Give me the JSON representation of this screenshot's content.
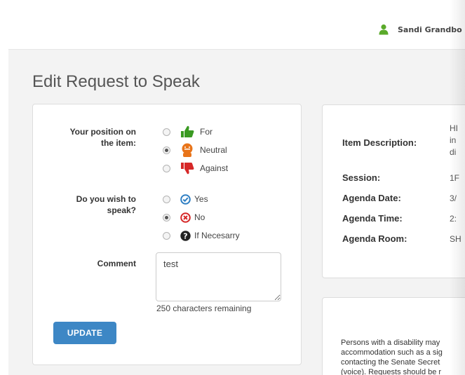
{
  "header": {
    "user_name": "Sandi Grandbo"
  },
  "page": {
    "title": "Edit Request to Speak"
  },
  "form": {
    "position": {
      "label_line1": "Your position on",
      "label_line2": "the item:",
      "options": [
        {
          "label": "For",
          "icon": "thumbs-up-icon",
          "color": "#3a9a22",
          "checked": false
        },
        {
          "label": "Neutral",
          "icon": "neutral-face-icon",
          "color": "#e8741a",
          "checked": true
        },
        {
          "label": "Against",
          "icon": "thumbs-down-icon",
          "color": "#d62828",
          "checked": false
        }
      ]
    },
    "speak": {
      "label_line1": "Do you wish to",
      "label_line2": "speak?",
      "options": [
        {
          "label": "Yes",
          "icon": "check-circle-icon",
          "color": "#2f7fc3",
          "checked": false
        },
        {
          "label": "No",
          "icon": "x-circle-icon",
          "color": "#d62828",
          "checked": true
        },
        {
          "label": "If Necesarry",
          "icon": "question-circle-icon",
          "color": "#222222",
          "checked": false
        }
      ]
    },
    "comment": {
      "label": "Comment",
      "value": "test",
      "chars_remaining": "250 characters remaining"
    },
    "update_button": "UPDATE"
  },
  "info": {
    "item_description_label": "Item Description:",
    "item_description_value": [
      "HI",
      "in",
      "di"
    ],
    "session_label": "Session:",
    "session_value": "1F",
    "agenda_date_label": "Agenda Date:",
    "agenda_date_value": "3/",
    "agenda_time_label": "Agenda Time:",
    "agenda_time_value": "2:",
    "agenda_room_label": "Agenda Room:",
    "agenda_room_value": "SH"
  },
  "note": {
    "lines": [
      "Persons with a disability may",
      "accommodation such as a sig",
      "contacting the Senate Secret",
      "(voice). Requests should be r"
    ]
  },
  "colors": {
    "accent": "#3d87c5",
    "user_icon": "#5aaa2a"
  }
}
